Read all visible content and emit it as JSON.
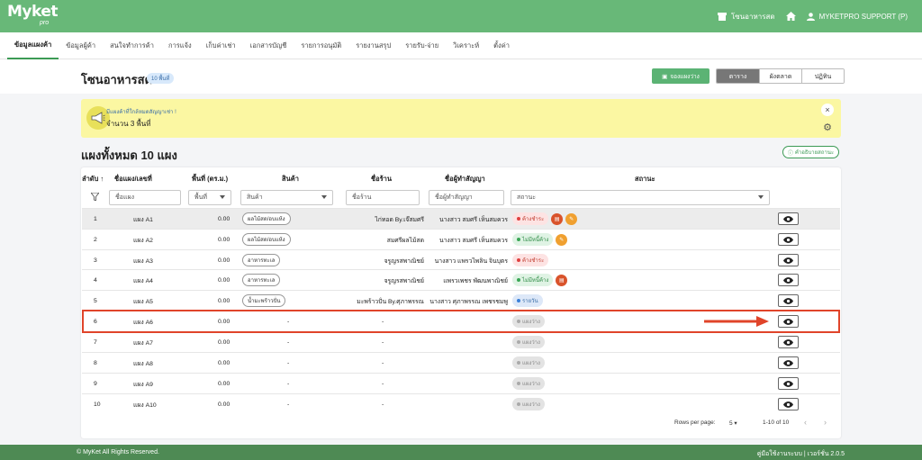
{
  "app": {
    "logo": "Myket",
    "logo_sub": "pro"
  },
  "topbar": {
    "market_name": "โซนอาหารสด",
    "user": "MYKETPRO SUPPORT (P)"
  },
  "nav": [
    "ข้อมูลแผงค้า",
    "ข้อมูลผู้ค้า",
    "สนใจทำการค้า",
    "การแจ้ง",
    "เก็บค่าเช่า",
    "เอกสารบัญชี",
    "รายการอนุมัติ",
    "รายงานสรุป",
    "รายรับ-จ่าย",
    "วิเคราะห์",
    "ตั้งค่า"
  ],
  "page": {
    "title": "โซนอาหารสด",
    "count_badge": "10 พื้นที่",
    "reserve_label": "จองแผงว่าง"
  },
  "view_tabs": [
    "ตาราง",
    "ผังตลาด",
    "ปฏิทิน"
  ],
  "alert": {
    "title": "มีแผงค้าที่ใกล้หมดสัญญาเช่า !",
    "text": "จำนวน 3 พื้นที่"
  },
  "section": {
    "title": "แผงทั้งหมด 10 แผง",
    "legend_btn": "คำอธิบายสถานะ"
  },
  "table": {
    "headers": {
      "order": "ลำดับ",
      "name": "ชื่อแผง/เลขที่",
      "area": "พื้นที่ (ตร.ม.)",
      "product": "สินค้า",
      "shop": "ชื่อร้าน",
      "tenant": "ชื่อผู้ทำสัญญา",
      "status": "สถานะ"
    },
    "filters": {
      "name": "ชื่อแผง",
      "area": "พื้นที่",
      "product": "สินค้า",
      "shop": "ชื่อร้าน",
      "tenant": "ชื่อผู้ทำสัญญา",
      "status": "สถานะ"
    },
    "rows": [
      {
        "no": "1",
        "name": "แผง A1",
        "area": "0.00",
        "product": "ผลไม้สด/อบแห้ง",
        "shop": "ไก่ทอด By.เจ๊สมศรี",
        "tenant": "นางสาว สมศรี เห็นสมควร",
        "status": "ค้างชำระ",
        "status_type": "red",
        "extra_icons": [
          "red",
          "orange"
        ]
      },
      {
        "no": "2",
        "name": "แผง A2",
        "area": "0.00",
        "product": "ผลไม้สด/อบแห้ง",
        "shop": "สมศรีผลไม้สด",
        "tenant": "นางสาว สมศรี เห็นสมควร",
        "status": "ไม่มีหนี้ค้าง",
        "status_type": "green",
        "extra_icons": [
          "orange"
        ]
      },
      {
        "no": "3",
        "name": "แผง A3",
        "area": "0.00",
        "product": "อาหารทะเล",
        "shop": "จรูญรสพาณิชย์",
        "tenant": "นางสาว แพรวไพลิน จินบุตร",
        "status": "ค้างชำระ",
        "status_type": "red",
        "extra_icons": []
      },
      {
        "no": "4",
        "name": "แผง A4",
        "area": "0.00",
        "product": "อาหารทะเล",
        "shop": "จรูญรสพาณิชย์",
        "tenant": "แพรวเพชร พัฒนพาณิชย์",
        "status": "ไม่มีหนี้ค้าง",
        "status_type": "green",
        "extra_icons": [
          "red"
        ]
      },
      {
        "no": "5",
        "name": "แผง A5",
        "area": "0.00",
        "product": "น้ำมะพร้าวปั่น",
        "shop": "มะพร้าวปั่น By.ศุภาพรรณ",
        "tenant": "นางสาว ศุภาพรรณ เพชรชมพู",
        "status": "รายวัน",
        "status_type": "blue",
        "extra_icons": []
      },
      {
        "no": "6",
        "name": "แผง A6",
        "area": "0.00",
        "product": "-",
        "shop": "-",
        "tenant": "",
        "status": "แผงว่าง",
        "status_type": "gray",
        "extra_icons": []
      },
      {
        "no": "7",
        "name": "แผง A7",
        "area": "0.00",
        "product": "-",
        "shop": "-",
        "tenant": "",
        "status": "แผงว่าง",
        "status_type": "gray",
        "extra_icons": []
      },
      {
        "no": "8",
        "name": "แผง A8",
        "area": "0.00",
        "product": "-",
        "shop": "-",
        "tenant": "",
        "status": "แผงว่าง",
        "status_type": "gray",
        "extra_icons": []
      },
      {
        "no": "9",
        "name": "แผง A9",
        "area": "0.00",
        "product": "-",
        "shop": "-",
        "tenant": "",
        "status": "แผงว่าง",
        "status_type": "gray",
        "extra_icons": []
      },
      {
        "no": "10",
        "name": "แผง A10",
        "area": "0.00",
        "product": "-",
        "shop": "-",
        "tenant": "",
        "status": "แผงว่าง",
        "status_type": "gray",
        "extra_icons": []
      }
    ]
  },
  "pagination": {
    "rows_label": "Rows per page:",
    "rows_value": "5",
    "range": "1-10 of 10"
  },
  "footer": {
    "left": "© MyKet All Rights Reserved.",
    "right": "คู่มือใช้งานระบบ | เวอร์ชั่น 2.0.5"
  },
  "colors": {
    "brand": "#68b878",
    "highlight": "#e0442a"
  }
}
